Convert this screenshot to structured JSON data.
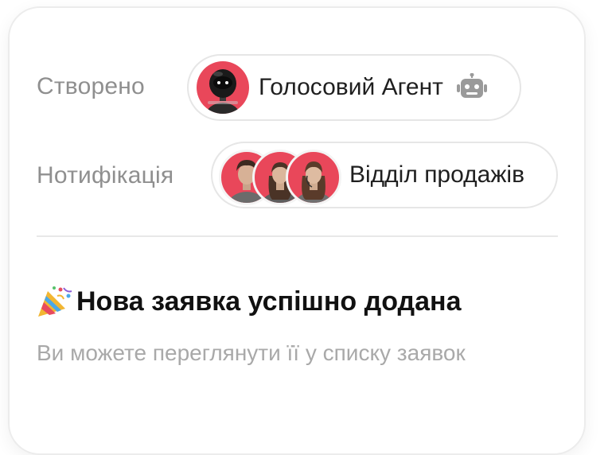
{
  "created": {
    "label": "Створено",
    "agent_name": "Голосовий Агент",
    "agent_icon": "robot-icon"
  },
  "notification": {
    "label": "Нотифікація",
    "team_name": "Відділ продажів"
  },
  "message": {
    "emoji": "🎉",
    "title": "Нова заявка успішно додана",
    "subtitle": "Ви можете переглянути її у списку заявок"
  },
  "colors": {
    "accent": "#e9475a",
    "muted_text": "#8f8f8f",
    "border": "#e6e6e6"
  }
}
